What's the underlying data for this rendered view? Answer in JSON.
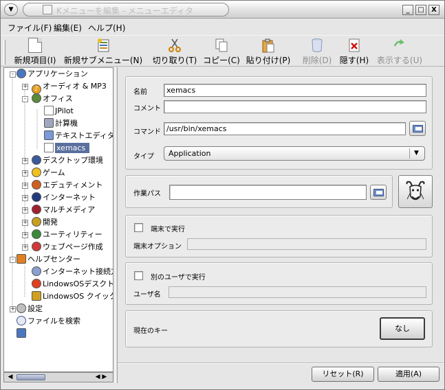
{
  "window": {
    "title": "Kメニューを編集 - メニューエディタ",
    "menu_glyph": "▼",
    "controls": {
      "minimize": "_",
      "maximize": "□",
      "close": "X"
    }
  },
  "menubar": {
    "items": [
      "ファイル(F)",
      "編集(E)",
      "ヘルプ(H)"
    ]
  },
  "toolbar": {
    "items": [
      {
        "label": "新規項目(I)",
        "icon": "new-item-icon",
        "enabled": true
      },
      {
        "label": "新規サブメニュー(N)",
        "icon": "new-submenu-icon",
        "enabled": true
      },
      {
        "label": "切り取り(T)",
        "icon": "scissors-icon",
        "enabled": true
      },
      {
        "label": "コピー(C)",
        "icon": "copy-icon",
        "enabled": true
      },
      {
        "label": "貼り付け(P)",
        "icon": "paste-icon",
        "enabled": true
      },
      {
        "label": "削除(D)",
        "icon": "trash-icon",
        "enabled": false
      },
      {
        "label": "隠す(H)",
        "icon": "hide-icon",
        "enabled": true
      },
      {
        "label": "表示する(U)",
        "icon": "show-icon",
        "enabled": false
      }
    ]
  },
  "tree": {
    "items": [
      {
        "label": "アプリケーション",
        "icon": "applications-icon"
      },
      {
        "label": "オーディオ & MP3",
        "icon": "audio-icon"
      },
      {
        "label": "オフィス",
        "icon": "office-icon"
      },
      {
        "label": "JPilot",
        "icon": "jpilot-icon"
      },
      {
        "label": "計算機",
        "icon": "calculator-icon"
      },
      {
        "label": "テキストエディタ",
        "icon": "text-editor-icon"
      },
      {
        "label": "xemacs",
        "icon": "xemacs-icon",
        "selected": true
      },
      {
        "label": "デスクトップ環境",
        "icon": "desktop-icon"
      },
      {
        "label": "ゲーム",
        "icon": "game-icon"
      },
      {
        "label": "エデュティメント",
        "icon": "edutainment-icon"
      },
      {
        "label": "インターネット",
        "icon": "internet-icon"
      },
      {
        "label": "マルチメディア",
        "icon": "multimedia-icon"
      },
      {
        "label": "開発",
        "icon": "development-icon"
      },
      {
        "label": "ユーティリティー",
        "icon": "utility-icon"
      },
      {
        "label": "ウェブページ作成",
        "icon": "webpage-icon"
      },
      {
        "label": "ヘルプセンター",
        "icon": "help-center-icon"
      },
      {
        "label": "インターネット接続方",
        "icon": "internet-connection-icon"
      },
      {
        "label": "LindowsOSデスクト",
        "icon": "lindows-desktop-icon"
      },
      {
        "label": "LindowsOS クイック",
        "icon": "lindows-quick-icon"
      },
      {
        "label": "設定",
        "icon": "settings-icon"
      },
      {
        "label": "ファイルを検索",
        "icon": "search-icon"
      },
      {
        "label": "",
        "icon": "computer-icon"
      }
    ],
    "scroll_left": "◀",
    "scroll_right": "◀ ▶"
  },
  "form": {
    "name_label": "名前",
    "name_value": "xemacs",
    "comment_label": "コメント",
    "comment_value": "",
    "command_label": "コマンド",
    "command_value": "/usr/bin/xemacs",
    "type_label": "タイプ",
    "type_value": "Application",
    "workpath_label": "作業パス",
    "workpath_value": "",
    "terminal_check_label": "端末で実行",
    "terminal_option_label": "端末オプション",
    "terminal_option_value": "",
    "other_user_check_label": "別のユーザで実行",
    "username_label": "ユーザ名",
    "username_value": "",
    "current_key_label": "現在のキー",
    "current_key_value": "なし"
  },
  "buttons": {
    "reset": "リセット(R)",
    "apply": "適用(A)"
  },
  "colors": {
    "selection": "#5a6f9e",
    "window_bg": "#e6e6e6"
  }
}
